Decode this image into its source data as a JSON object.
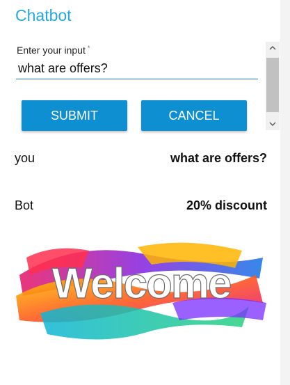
{
  "app": {
    "title": "Chatbot"
  },
  "form": {
    "label": "Enter your input",
    "required_mark": "*",
    "input_value": "what are offers?",
    "submit_label": "SUBMIT",
    "cancel_label": "CANCEL"
  },
  "chat": [
    {
      "sender": "you",
      "message": "what are offers?"
    },
    {
      "sender": "Bot",
      "message": "20% discount"
    }
  ],
  "banner": {
    "text": "Welcome"
  },
  "colors": {
    "accent": "#27a8e0",
    "button": "#0e8fd1",
    "underline": "#1976c5"
  }
}
